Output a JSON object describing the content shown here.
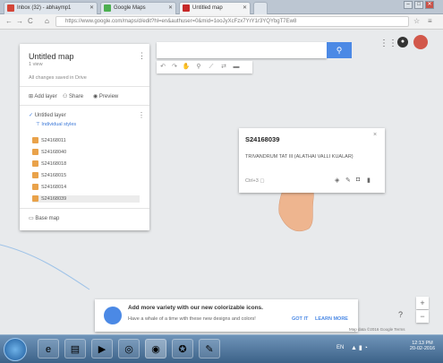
{
  "browser": {
    "tabs": [
      {
        "label": "Inbox (32) - abhaymp1",
        "active": false
      },
      {
        "label": "Google Maps",
        "active": false
      },
      {
        "label": "Untitled map",
        "active": true
      }
    ],
    "url": "https://www.google.com/maps/d/edit?hl=en&authuser=0&mid=1ooJyXcFzx7YrY1r3YQYbgT7Ew8"
  },
  "panel": {
    "title": "Untitled map",
    "views": "1 view",
    "description": "All changes saved in Drive",
    "add_layer": "Add layer",
    "share": "Share",
    "preview": "Preview",
    "layer_name": "Untitled layer",
    "style_link": "Individual styles",
    "items": [
      "S24168011",
      "S24168040",
      "S24168018",
      "S24168015",
      "S24168014",
      "S24168039"
    ],
    "base_map": "Base map"
  },
  "popup": {
    "title": "S24168039",
    "description": "TRIVANDRUM TAT III (ALATHAI VALLI KUALAR)",
    "status": "Ctrl+3"
  },
  "banner": {
    "title": "Add more variety with our new colorizable icons.",
    "body": "Have a whale of a time with these new designs and colors!",
    "got_it": "GOT IT",
    "learn_more": "LEARN MORE"
  },
  "map_footer": "Map data ©2016 Google  Terms",
  "taskbar": {
    "lang": "EN",
    "time": "12:13 PM",
    "date": "20-02-2016"
  }
}
